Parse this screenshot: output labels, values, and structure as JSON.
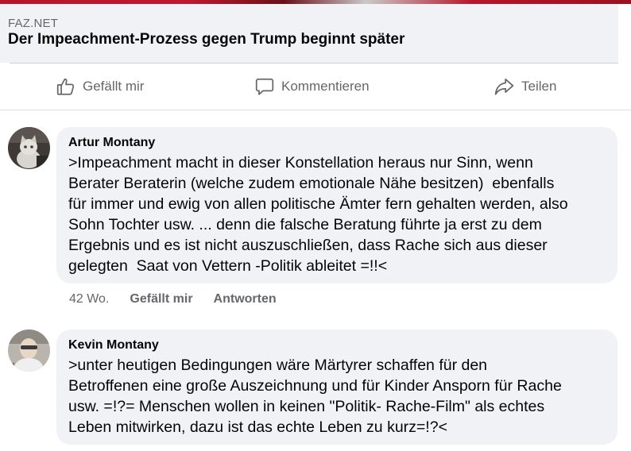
{
  "link_preview": {
    "source": "FAZ.NET",
    "title": "Der Impeachment-Prozess gegen Trump beginnt später"
  },
  "actions": {
    "like_label": "Gefällt mir",
    "comment_label": "Kommentieren",
    "share_label": "Teilen"
  },
  "comments": [
    {
      "author": "Artur Montany",
      "text": ">Impeachment macht in dieser Konstellation heraus nur Sinn, wenn\nBerater Beraterin (welche zudem emotionale Nähe besitzen)  ebenfalls\nfür immer und ewig von allen politische Ämter fern gehalten werden, also\nSohn Tochter usw. ... denn die falsche Beratung führte ja erst zu dem\nErgebnis und es ist nicht auszuschließen, dass Rache sich aus dieser\ngelegten  Saat von Vettern -Politik ableitet =!!<",
      "time": "42 Wo.",
      "like_label": "Gefällt mir",
      "reply_label": "Antworten"
    },
    {
      "author": "Kevin Montany",
      "text": ">unter heutigen Bedingungen wäre Märtyrer schaffen für den\nBetroffenen eine große Auszeichnung und für Kinder Ansporn für Rache\nusw. =!?= Menschen wollen in keinen \"Politik- Rache-Film\" als echtes\nLeben mitwirken, dazu ist das echte Leben zu kurz=!?<"
    }
  ],
  "colors": {
    "bubble_bg": "#f0f2f5",
    "secondary_text": "#65676b",
    "primary_text": "#050505"
  },
  "icons": {
    "like": "thumbs-up-icon",
    "comment": "speech-bubble-icon",
    "share": "share-arrow-icon"
  }
}
